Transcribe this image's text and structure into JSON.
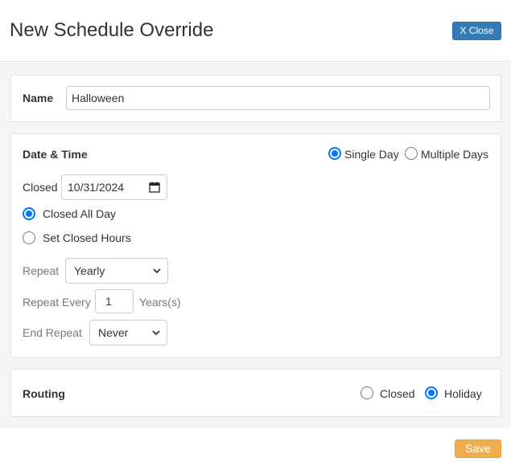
{
  "header": {
    "title": "New Schedule Override",
    "close_label": "X Close"
  },
  "name_section": {
    "label": "Name",
    "value": "Halloween"
  },
  "datetime_section": {
    "label": "Date & Time",
    "mode_options": [
      {
        "label": "Single Day",
        "checked": true
      },
      {
        "label": "Multiple Days",
        "checked": false
      }
    ],
    "closed_label": "Closed",
    "closed_date": "10/31/2024",
    "hours_options": [
      {
        "label": "Closed All Day",
        "checked": true
      },
      {
        "label": "Set Closed Hours",
        "checked": false
      }
    ],
    "repeat_label": "Repeat",
    "repeat_value": "Yearly",
    "repeat_every_label": "Repeat Every",
    "repeat_every_value": "1",
    "repeat_every_unit": "Years(s)",
    "end_repeat_label": "End Repeat",
    "end_repeat_value": "Never"
  },
  "routing_section": {
    "label": "Routing",
    "options": [
      {
        "label": "Closed",
        "checked": false
      },
      {
        "label": "Holiday",
        "checked": true
      }
    ]
  },
  "footer": {
    "save_label": "Save"
  },
  "colors": {
    "primary": "#337ab7",
    "warning": "#f0ad4e",
    "radio_accent": "#0075ff",
    "background": "#f5f5f5"
  }
}
